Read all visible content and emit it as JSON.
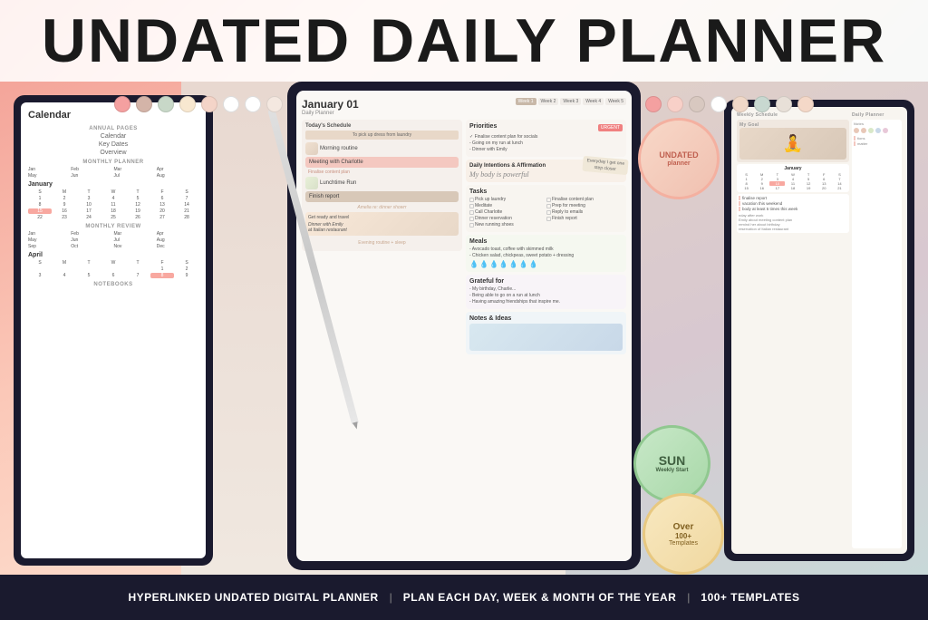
{
  "title": "UNDATED DAILY PLANNER",
  "footer": {
    "part1": "HYPERLINKED UNDATED DIGITAL PLANNER",
    "sep1": "|",
    "part2": "PLAN EACH DAY, WEEK & MONTH OF THE YEAR",
    "sep2": "|",
    "part3": "100+ TEMPLATES"
  },
  "dots": {
    "left": [
      "#f4a0a0",
      "#d4b4a8",
      "#c8d8c8",
      "#f8e8d0",
      "#f4d4c8",
      "#fff",
      "#fff",
      "#f4e8e0"
    ],
    "right": [
      "#f4a0a0",
      "#f8d0c8",
      "#d8c8c0",
      "#fff",
      "#f0d8c8",
      "#c8d8d0",
      "#e8e0d8",
      "#f4d8c8"
    ]
  },
  "center_device": {
    "date": "January 01",
    "subtitle": "Daily Planner",
    "week_tabs": [
      "Week 1",
      "Week 2",
      "Week 3",
      "Week 4",
      "Week 5"
    ],
    "todays_schedule": {
      "title": "Today's Schedule",
      "reminder": "To pick up dress from laundry",
      "items": [
        "Morning routine",
        "Meeting with Charlotte",
        "Finalise content plan",
        "Lunchtime Run",
        "Finish report"
      ]
    },
    "priorities": {
      "title": "Priorities",
      "urgent": "URGENT",
      "items": [
        "Finalise content plan for socials",
        "Going on my run at lunch",
        "Dinner with Emily"
      ]
    },
    "daily_intentions": {
      "title": "Daily Intentions & Affirmation",
      "affirmation": "My body is powerful",
      "sticky": "Everyday I get one step closer"
    },
    "tasks": {
      "title": "Tasks",
      "items_left": [
        "Pick up laundry",
        "Meditate",
        "Call Charlotte",
        "Dinner reservation",
        "New running shoes"
      ],
      "items_right": [
        "Finalise content plan",
        "Prep for meeting",
        "Reply to emails",
        "Finish report"
      ]
    },
    "meals": {
      "title": "Meals",
      "items": [
        "Avocado toast, coffee with skimmed milk",
        "Chicken salad, chickpeas, sweet potato + dressing"
      ]
    },
    "grateful": {
      "title": "Grateful for",
      "items": [
        "My birthday, Charlie...",
        "Being able to go on a run at lunch",
        "Having amazing friendships that inspire me."
      ]
    },
    "notes": {
      "title": "Notes & Ideas"
    }
  },
  "left_device": {
    "title": "Calendar",
    "nav_items": [
      "Calendar",
      "Key Dates",
      "Overview"
    ],
    "sections": {
      "annual": "ANNUAL PAGES",
      "monthly_planner": "MONTHLY PLANNER",
      "monthly_review": "MONTHLY REVIEW",
      "notebooks": "NOTEBOOKS"
    },
    "months": [
      "January",
      "April",
      "July",
      "October"
    ]
  },
  "right_device": {
    "goal": "My Goal",
    "calendar_month": "January",
    "daily_entries": [
      "finalise report",
      "vacation this weekend",
      "body at least 5 times this week"
    ]
  },
  "badges": {
    "undated": {
      "line1": "UNDATED",
      "line2": "planner"
    },
    "sun": {
      "day": "SUN",
      "text": "Weekly Start"
    },
    "templates": {
      "line1": "Over",
      "line2": "100+",
      "line3": "Templates"
    }
  }
}
